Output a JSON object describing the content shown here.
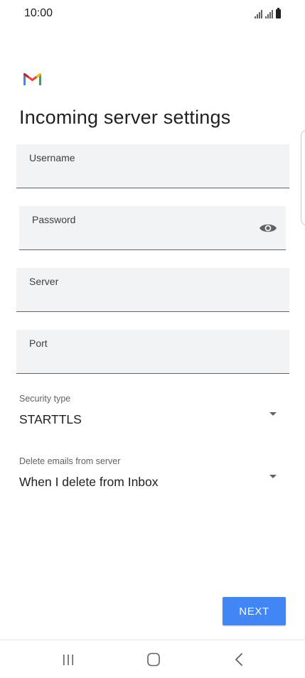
{
  "status_bar": {
    "time": "10:00"
  },
  "colors": {
    "accent": "#4285f4",
    "field_bg": "#f1f3f4"
  },
  "page": {
    "title": "Incoming server settings"
  },
  "form": {
    "username": {
      "label": "Username",
      "value": ""
    },
    "password": {
      "label": "Password",
      "value": ""
    },
    "server": {
      "label": "Server",
      "value": ""
    },
    "port": {
      "label": "Port",
      "value": ""
    }
  },
  "security": {
    "label": "Security type",
    "value": "STARTTLS"
  },
  "delete_emails": {
    "label": "Delete emails from server",
    "value": "When I delete from Inbox"
  },
  "actions": {
    "next_label": "NEXT"
  },
  "icons": {
    "logo": "gmail-logo",
    "password_toggle": "eye-icon",
    "dropdown": "caret-down-icon",
    "nav_recents": "recent-apps-icon",
    "nav_home": "home-icon",
    "nav_back": "back-icon"
  }
}
